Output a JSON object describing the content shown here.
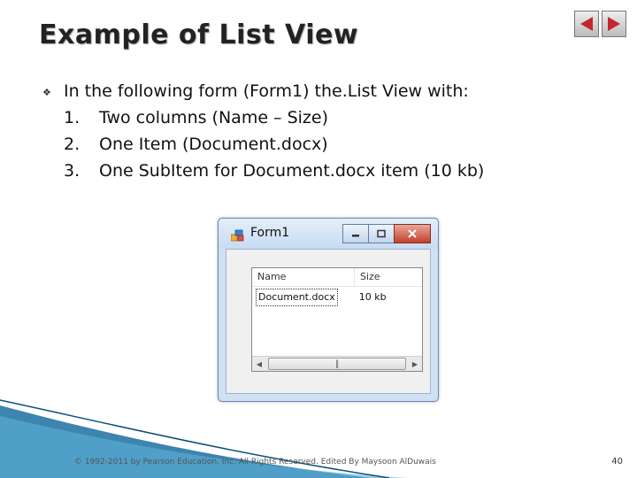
{
  "slide": {
    "title": "Example of List View",
    "bullet": "In the following form (Form1) the.List View with:",
    "items": [
      {
        "num": "1.",
        "text": "Two columns (Name – Size)"
      },
      {
        "num": "2.",
        "text": "One Item (Document.docx)"
      },
      {
        "num": "3.",
        "text": "One SubItem for Document.docx item (10 kb)"
      }
    ]
  },
  "form": {
    "title": "Form1",
    "columns": [
      "Name",
      "Size"
    ],
    "rows": [
      {
        "name": "Document.docx",
        "size": "10 kb"
      }
    ]
  },
  "footer": {
    "copyright": "© 1992-2011 by Pearson Education, Inc. All Rights Reserved. Edited By Maysoon AlDuwais",
    "page": "40"
  },
  "colors": {
    "nav_arrow": "#c1272d",
    "titlebar": "#c6dbf2",
    "close_button": "#c3412b"
  }
}
